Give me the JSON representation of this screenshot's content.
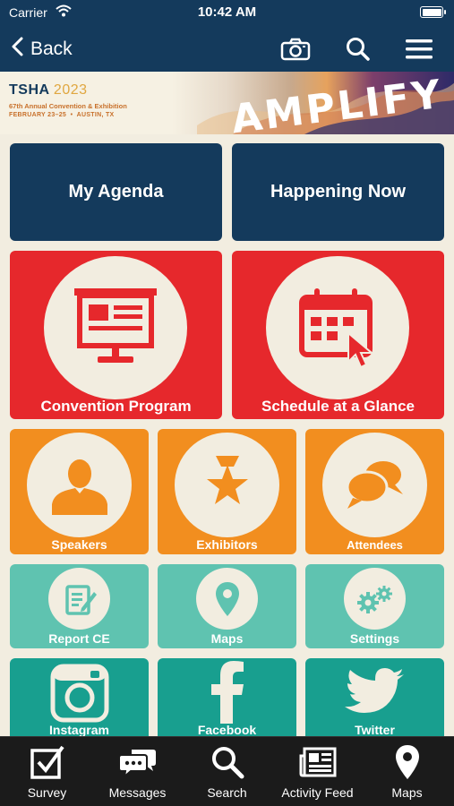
{
  "status_bar": {
    "carrier": "Carrier",
    "time": "10:42 AM"
  },
  "nav": {
    "back_label": "Back",
    "icons": [
      "camera-icon",
      "search-icon",
      "menu-icon"
    ]
  },
  "banner": {
    "org": "TSHA",
    "year": "2023",
    "subtitle": "67th Annual Convention & Exhibition",
    "dates": "FEBRUARY 23–25",
    "location": "AUSTIN, TX",
    "theme": "AMPLIFY"
  },
  "tiles": {
    "my_agenda": "My Agenda",
    "happening_now": "Happening Now",
    "convention_program": "Convention Program",
    "schedule_at_a_glance": "Schedule at a Glance",
    "speakers": "Speakers",
    "exhibitors": "Exhibitors",
    "attendees": "Attendees",
    "report_ce": "Report CE",
    "maps": "Maps",
    "settings": "Settings",
    "instagram": "Instagram",
    "facebook": "Facebook",
    "twitter": "Twitter"
  },
  "tabbar": {
    "items": [
      {
        "label": "Survey",
        "icon": "survey-checkbox-icon"
      },
      {
        "label": "Messages",
        "icon": "messages-icon"
      },
      {
        "label": "Search",
        "icon": "search-icon"
      },
      {
        "label": "Activity Feed",
        "icon": "activity-feed-icon"
      },
      {
        "label": "Maps",
        "icon": "map-pin-icon"
      }
    ]
  },
  "colors": {
    "navy": "#143a5c",
    "red": "#e6282c",
    "orange": "#f28e1f",
    "mint": "#5fc3b0",
    "teal": "#189f8f",
    "cream": "#f2ede0",
    "tabbar": "#1b1b1b"
  }
}
